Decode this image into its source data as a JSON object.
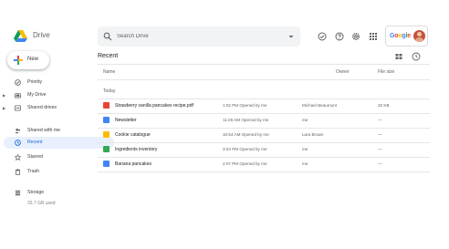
{
  "app": {
    "name": "Drive"
  },
  "search": {
    "placeholder": "Search Drive"
  },
  "account": {
    "brand": [
      "G",
      "o",
      "o",
      "g",
      "l",
      "e"
    ],
    "brand_colors": [
      "#4285f4",
      "#ea4335",
      "#fbbc05",
      "#4285f4",
      "#34a853",
      "#ea4335"
    ]
  },
  "toolbar_icons": [
    "offline-status-icon",
    "help-icon",
    "settings-icon",
    "apps-grid-icon"
  ],
  "new_button": {
    "label": "New"
  },
  "sidebar": {
    "items": [
      {
        "label": "Priority",
        "icon": "priority-icon",
        "expandable": false
      },
      {
        "label": "My Drive",
        "icon": "my-drive-icon",
        "expandable": true
      },
      {
        "label": "Shared drives",
        "icon": "shared-drives-icon",
        "expandable": true
      },
      {
        "label": "Shared with me",
        "icon": "shared-with-me-icon",
        "expandable": false
      },
      {
        "label": "Recent",
        "icon": "recent-icon",
        "expandable": false,
        "active": true
      },
      {
        "label": "Starred",
        "icon": "star-icon",
        "expandable": false
      },
      {
        "label": "Trash",
        "icon": "trash-icon",
        "expandable": false
      },
      {
        "label": "Storage",
        "icon": "storage-icon",
        "expandable": false
      }
    ],
    "storage_used": "33.7 GB used"
  },
  "main": {
    "title": "Recent",
    "columns": {
      "name": "Name",
      "owner": "Owner",
      "size": "File size"
    },
    "group": "Today",
    "rows": [
      {
        "name": "Strawberry vanilla pancakes recipe.pdf",
        "modified": "1:02 PM Opened by me",
        "owner": "Michael Beaumont",
        "size": "33 KB",
        "type": "pdf",
        "color": "#ea4335"
      },
      {
        "name": "Newsletter",
        "modified": "11:26 AM Opened by me",
        "owner": "me",
        "size": "—",
        "type": "doc",
        "color": "#4285f4"
      },
      {
        "name": "Cookie catalogue",
        "modified": "10:54 AM Opened by me",
        "owner": "Lara Brown",
        "size": "—",
        "type": "slides",
        "color": "#fbbc04"
      },
      {
        "name": "Ingredients inventory",
        "modified": "3:04 PM Opened by me",
        "owner": "me",
        "size": "—",
        "type": "sheet",
        "color": "#34a853"
      },
      {
        "name": "Banana pancakes",
        "modified": "2:07 PM Opened by me",
        "owner": "me",
        "size": "—",
        "type": "doc",
        "color": "#4285f4"
      }
    ]
  },
  "colors": {
    "accent": "#1967d2",
    "active_bg": "#e8f0fe"
  }
}
